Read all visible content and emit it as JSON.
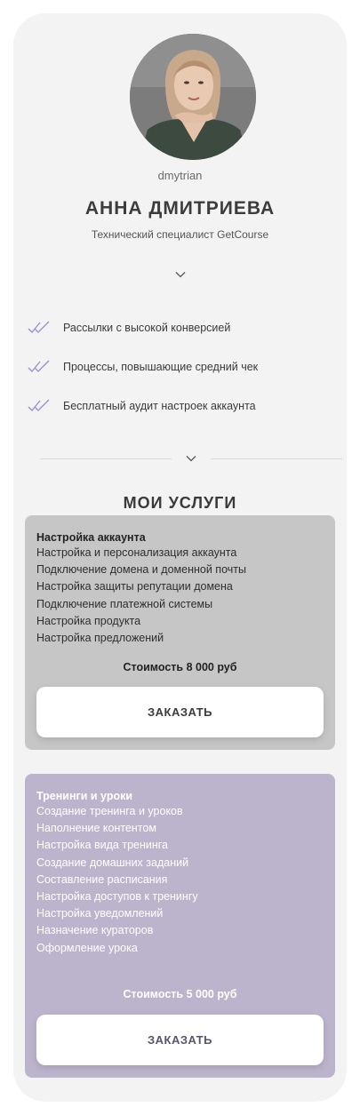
{
  "profile": {
    "username": "dmytrian",
    "name": "АННА ДМИТРИЕВА",
    "role": "Технический специалист GetCourse",
    "avatar": "profile-photo"
  },
  "features": [
    {
      "icon": "double-check-icon",
      "label": "Рассылки с высокой конверсией"
    },
    {
      "icon": "double-check-icon",
      "label": "Процессы, повышающие средний чек"
    },
    {
      "icon": "double-check-icon",
      "label": "Бесплатный аудит настроек аккаунта"
    }
  ],
  "services_title": "МОИ УСЛУГИ",
  "services": [
    {
      "title": "Настройка аккаунта",
      "items": [
        "Настройка и персонализация аккаунта",
        "Подключение домена и доменной почты",
        "Настройка защиты репутации домена",
        "Подключение платежной системы",
        "Настройка продукта",
        "Настройка предложений"
      ],
      "price": "Стоимость 8 000 руб",
      "button": "ЗАКАЗАТЬ",
      "color": "#c6c6c6"
    },
    {
      "title": "Тренинги и уроки",
      "items": [
        "Создание тренинга и уроков",
        "Наполнение контентом",
        "Настройка вида тренинга",
        "Создание домашних заданий",
        "Составление расписания",
        "Настройка доступов к тренингу",
        "Настройка уведомлений",
        "Назначение кураторов",
        "Оформление урока"
      ],
      "price": "Стоимость 5 000 руб",
      "button": "ЗАКАЗАТЬ",
      "color": "#bcb4cc"
    }
  ],
  "colors": {
    "check": "#9b8ccf",
    "card_bg": "#f3f3f3"
  }
}
